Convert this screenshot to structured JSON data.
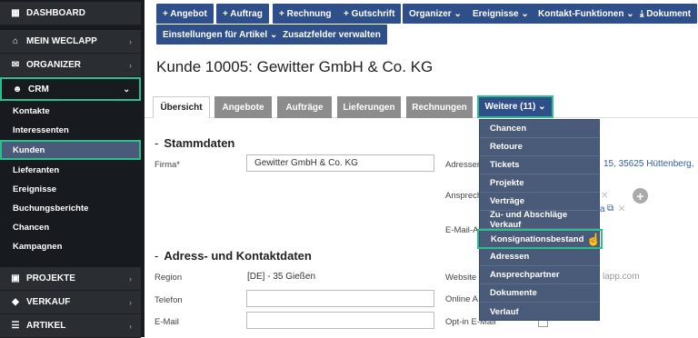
{
  "sidebar": {
    "main": [
      {
        "label": "DASHBOARD",
        "icon": "dashboard-icon",
        "glyph": "▦"
      },
      {
        "label": "MEIN WECLAPP",
        "icon": "home-icon",
        "glyph": "⌂"
      },
      {
        "label": "ORGANIZER",
        "icon": "inbox-icon",
        "glyph": "✉"
      },
      {
        "label": "CRM",
        "icon": "users-icon",
        "glyph": "☻"
      },
      {
        "label": "PROJEKTE",
        "icon": "briefcase-icon",
        "glyph": "▣"
      },
      {
        "label": "VERKAUF",
        "icon": "tag-icon",
        "glyph": "◆"
      },
      {
        "label": "ARTIKEL",
        "icon": "list-icon",
        "glyph": "☰"
      }
    ],
    "crm_items": [
      "Kontakte",
      "Interessenten",
      "Kunden",
      "Lieferanten",
      "Ereignisse",
      "Buchungsberichte",
      "Chancen",
      "Kampagnen"
    ],
    "active_item": "Kunden"
  },
  "toolbar": {
    "buttons": [
      "+ Angebot",
      "+ Auftrag",
      "+ Rechnung",
      "+ Gutschrift",
      "Organizer ⌄",
      "Ereignisse ⌄",
      "Kontakt-Funktionen ⌄",
      "⤓ Dokument",
      "Einstellungen für Artikel ⌄",
      "Zusatzfelder verwalten"
    ]
  },
  "page": {
    "title": "Kunde 10005: Gewitter GmbH & Co. KG"
  },
  "tabs": [
    "Übersicht",
    "Angebote",
    "Aufträge",
    "Lieferungen",
    "Rechnungen",
    "Weitere (11) ⌄"
  ],
  "stammdaten": {
    "heading": "Stammdaten",
    "firma_label": "Firma*",
    "firma_value": "Gewitter GmbH & Co. KG",
    "adressen_label": "Adressen",
    "adressen_value": "15, 35625 Hüttenberg,",
    "ansprech_label": "Ansprech",
    "email_label": "E-Mail-A"
  },
  "adress": {
    "heading": "Adress- und Kontaktdaten",
    "region_label": "Region",
    "region_value": "[DE] - 35 Gießen",
    "telefon_label": "Telefon",
    "email_label": "E-Mail",
    "website_label": "Website",
    "website_value": "lapp.com",
    "online_label": "Online A",
    "optin_label": "Opt-in E-Mail"
  },
  "dropdown": {
    "items": [
      "Chancen",
      "Retoure",
      "Tickets",
      "Projekte",
      "Verträge",
      "Zu- und Abschläge Verkauf",
      "Konsignationsbestand",
      "Adressen",
      "Ansprechpartner",
      "Dokumente",
      "Verlauf"
    ],
    "highlighted": "Konsignationsbestand"
  },
  "colors": {
    "accent": "#2bbf8e",
    "primary_button": "#2f4f8a",
    "sidebar_bg": "#171a1e",
    "dropdown_bg": "#4a5b7a"
  }
}
